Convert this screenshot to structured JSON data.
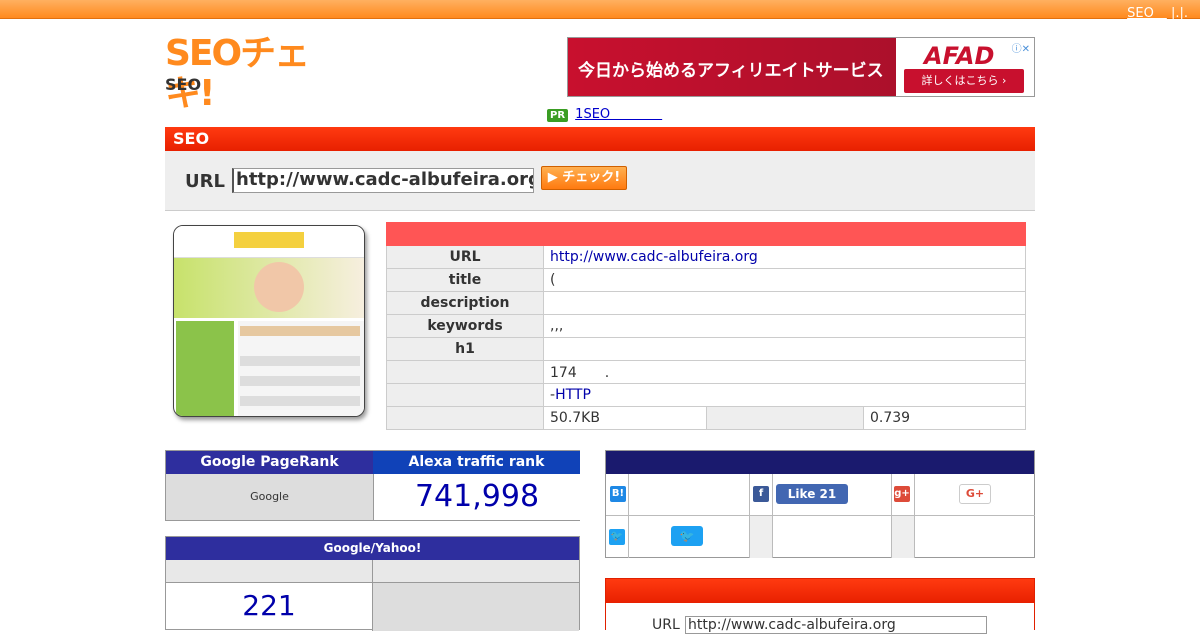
{
  "topbar": {
    "link": "SEO　",
    "sep": "|.|."
  },
  "logo": {
    "text": "SEOチェキ!",
    "sub": "SEO"
  },
  "ad": {
    "headline": "今日から始めるアフィリエイトサービス",
    "brand": "AFAD",
    "button": "詳しくはこちら ›",
    "info": "ⓘ✕"
  },
  "pr": {
    "badge": "PR",
    "link": "1SEO　　　　"
  },
  "seo_bar": {
    "title": "SEO"
  },
  "url_form": {
    "label": "URL",
    "value": "http://www.cadc-albufeira.org",
    "button": "▶ チェック!"
  },
  "info_table": {
    "rows": [
      {
        "label": "URL",
        "value": "http://www.cadc-albufeira.org"
      },
      {
        "label": "title",
        "value": "("
      },
      {
        "label": "description",
        "value": ""
      },
      {
        "label": "keywords",
        "value": ",,,"
      },
      {
        "label": "h1",
        "value": ""
      },
      {
        "label": "",
        "value": "174　　."
      },
      {
        "label": "",
        "value_prefix": "-",
        "value_link": "HTTP"
      }
    ],
    "size": {
      "label": "",
      "value": "50.7KB",
      "label2": "",
      "value2": "0.739"
    }
  },
  "pagerank": {
    "header_left": "Google PageRank",
    "header_right": "Alexa traffic rank",
    "left_value": "Google",
    "right_value": "741,998"
  },
  "index": {
    "header": "Google/Yahoo!",
    "google_value": "221"
  },
  "social": {
    "hatena_icon": "B!",
    "fb_label": "Like 21",
    "gplus_label": "G+",
    "gplus_icon": "g+",
    "fb_icon": "f",
    "tw_icon": "🐦",
    "tw_btn": "🐦"
  },
  "bottom_form": {
    "label": "URL",
    "value": "http://www.cadc-albufeira.org"
  }
}
